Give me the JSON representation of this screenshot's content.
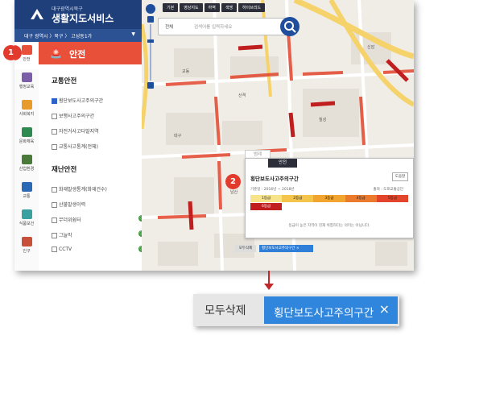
{
  "header": {
    "subtitle": "대구광역시북구",
    "title": "생활지도서비스",
    "region_select": "대구 광역시 〉북구 〉 고성동1가"
  },
  "nav": [
    {
      "label": "안전",
      "color": "#e8503a"
    },
    {
      "label": "행정교육",
      "color": "#7a5ea8"
    },
    {
      "label": "사회복지",
      "color": "#e89a2a"
    },
    {
      "label": "문화체육",
      "color": "#2f8a52"
    },
    {
      "label": "산업환경",
      "color": "#4a7a3a"
    },
    {
      "label": "교통",
      "color": "#2d6ab5"
    },
    {
      "label": "식품보건",
      "color": "#3aa0a0"
    },
    {
      "label": "인구",
      "color": "#c8503a"
    }
  ],
  "category": {
    "title": "안전",
    "sections": [
      {
        "title": "교통안전",
        "options": [
          {
            "label": "횡단보도사고주의구간",
            "checked": true
          },
          {
            "label": "보행사고주의구간",
            "checked": false
          },
          {
            "label": "자전거사고다발지역",
            "checked": false
          },
          {
            "label": "교통사고통계(전체)",
            "checked": false
          }
        ]
      },
      {
        "title": "재난안전",
        "options": [
          {
            "label": "화재발생통계(화재건수)",
            "checked": false
          },
          {
            "label": "산불발생이력",
            "checked": false
          },
          {
            "label": "무더위쉼터",
            "checked": false,
            "icon": "ⓘ"
          },
          {
            "label": "그늘막",
            "checked": false,
            "icon": "ⓘ"
          },
          {
            "label": "CCTV",
            "checked": false,
            "icon": "ⓘ"
          }
        ]
      }
    ]
  },
  "map": {
    "base_tabs": [
      "기본",
      "영상지도",
      "하역",
      "색맹",
      "하이브리드"
    ],
    "search_scope": "전체",
    "search_placeholder": "검색어를 입력하세요"
  },
  "popup": {
    "side_tab": "범례",
    "tab": "안전",
    "title": "횡단보도사고주의구간",
    "button": "도움말",
    "period": "기준일 : 2016년 ~ 2018년",
    "source": "출처 : 도로교통공단",
    "grades": [
      {
        "label": "1등급",
        "color": "#f7e38a"
      },
      {
        "label": "2등급",
        "color": "#f4c54a"
      },
      {
        "label": "3등급",
        "color": "#f2a52e"
      },
      {
        "label": "4등급",
        "color": "#ec7a2c"
      },
      {
        "label": "5등급",
        "color": "#e2442c"
      },
      {
        "label": "6등급",
        "color": "#c11f1f"
      }
    ],
    "note": "등급이 높은 지역이 현재 위험하다는 의미는 아닙니다."
  },
  "active_layers": {
    "clear_label": "모두삭제",
    "chip_label": "횡단보도사고주의구간",
    "chip_close": "×"
  },
  "badges": [
    "1",
    "2"
  ]
}
